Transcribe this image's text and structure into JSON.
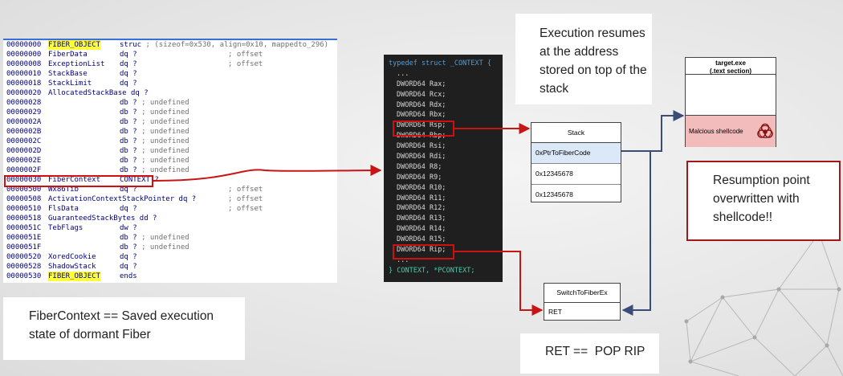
{
  "ida_listing": [
    {
      "addr": "00000000",
      "name": "FIBER_OBJECT",
      "type": "struc ; (sizeof=0x530, align=0x10, mappedto_296)",
      "comment": "",
      "highlight": true
    },
    {
      "addr": "00000000",
      "name": "FiberData",
      "type": "dq ?",
      "comment": "; offset"
    },
    {
      "addr": "00000008",
      "name": "ExceptionList",
      "type": "dq ?",
      "comment": "; offset"
    },
    {
      "addr": "00000010",
      "name": "StackBase",
      "type": "dq ?",
      "comment": ""
    },
    {
      "addr": "00000018",
      "name": "StackLimit",
      "type": "dq ?",
      "comment": ""
    },
    {
      "addr": "00000020",
      "name": "AllocatedStackBase dq ?",
      "type": "",
      "comment": ""
    },
    {
      "addr": "00000028",
      "name": "",
      "type": "db ? ; undefined",
      "comment": ""
    },
    {
      "addr": "00000029",
      "name": "",
      "type": "db ? ; undefined",
      "comment": ""
    },
    {
      "addr": "0000002A",
      "name": "",
      "type": "db ? ; undefined",
      "comment": ""
    },
    {
      "addr": "0000002B",
      "name": "",
      "type": "db ? ; undefined",
      "comment": ""
    },
    {
      "addr": "0000002C",
      "name": "",
      "type": "db ? ; undefined",
      "comment": ""
    },
    {
      "addr": "0000002D",
      "name": "",
      "type": "db ? ; undefined",
      "comment": ""
    },
    {
      "addr": "0000002E",
      "name": "",
      "type": "db ? ; undefined",
      "comment": ""
    },
    {
      "addr": "0000002F",
      "name": "",
      "type": "db ? ; undefined",
      "comment": ""
    },
    {
      "addr": "00000030",
      "name": "FiberContext",
      "type": "CONTEXT ?",
      "comment": ""
    },
    {
      "addr": "00000500",
      "name": "Wx86Tib",
      "type": "dq ?",
      "comment": "; offset"
    },
    {
      "addr": "00000508",
      "name": "ActivationContextStackPointer dq ?",
      "type": "",
      "comment": "; offset"
    },
    {
      "addr": "00000510",
      "name": "FlsData",
      "type": "dq ?",
      "comment": "; offset"
    },
    {
      "addr": "00000518",
      "name": "GuaranteedStackBytes dd ?",
      "type": "",
      "comment": ""
    },
    {
      "addr": "0000051C",
      "name": "TebFlags",
      "type": "dw ?",
      "comment": ""
    },
    {
      "addr": "0000051E",
      "name": "",
      "type": "db ? ; undefined",
      "comment": ""
    },
    {
      "addr": "0000051F",
      "name": "",
      "type": "db ? ; undefined",
      "comment": ""
    },
    {
      "addr": "00000520",
      "name": "XoredCookie",
      "type": "dq ?",
      "comment": ""
    },
    {
      "addr": "00000528",
      "name": "ShadowStack",
      "type": "dq ?",
      "comment": ""
    },
    {
      "addr": "00000530",
      "name": "FIBER_OBJECT",
      "type": "ends",
      "comment": "",
      "highlight": true
    }
  ],
  "context_struct": {
    "header_kw": "typedef struct",
    "header_name": "_CONTEXT {",
    "ellipsis": "...",
    "fields": [
      {
        "type": "DWORD64",
        "name": "Rax;"
      },
      {
        "type": "DWORD64",
        "name": "Rcx;"
      },
      {
        "type": "DWORD64",
        "name": "Rdx;"
      },
      {
        "type": "DWORD64",
        "name": "Rbx;"
      },
      {
        "type": "DWORD64",
        "name": "Rsp;"
      },
      {
        "type": "DWORD64",
        "name": "Rbp;"
      },
      {
        "type": "DWORD64",
        "name": "Rsi;"
      },
      {
        "type": "DWORD64",
        "name": "Rdi;"
      },
      {
        "type": "DWORD64",
        "name": "R8;"
      },
      {
        "type": "DWORD64",
        "name": "R9;"
      },
      {
        "type": "DWORD64",
        "name": "R10;"
      },
      {
        "type": "DWORD64",
        "name": "R11;"
      },
      {
        "type": "DWORD64",
        "name": "R12;"
      },
      {
        "type": "DWORD64",
        "name": "R13;"
      },
      {
        "type": "DWORD64",
        "name": "R14;"
      },
      {
        "type": "DWORD64",
        "name": "R15;"
      },
      {
        "type": "DWORD64",
        "name": "Rip;"
      }
    ],
    "footer": "} CONTEXT, *PCONTEXT;"
  },
  "stack": {
    "title": "Stack",
    "rows": [
      "0xPtrToFiberCode",
      "0x12345678",
      "0x12345678"
    ]
  },
  "target_exe": {
    "title_line1": "target.exe",
    "title_line2": "(.text section)",
    "shellcode_label": "Malcious shellcode",
    "icon": "biohazard-icon"
  },
  "switch_box": {
    "title": "SwitchToFiberEx",
    "row": "RET"
  },
  "notes": {
    "execution": "Execution resumes at the address stored on top of the stack",
    "resumption": "Resumption point overwritten with shellcode!!",
    "fiber_context": "FiberContext == Saved execution state of dormant Fiber",
    "ret": "RET ==  POP RIP"
  },
  "colors": {
    "red": "#c81414",
    "navy": "#3a4d78",
    "highlight": "#ffff40"
  }
}
